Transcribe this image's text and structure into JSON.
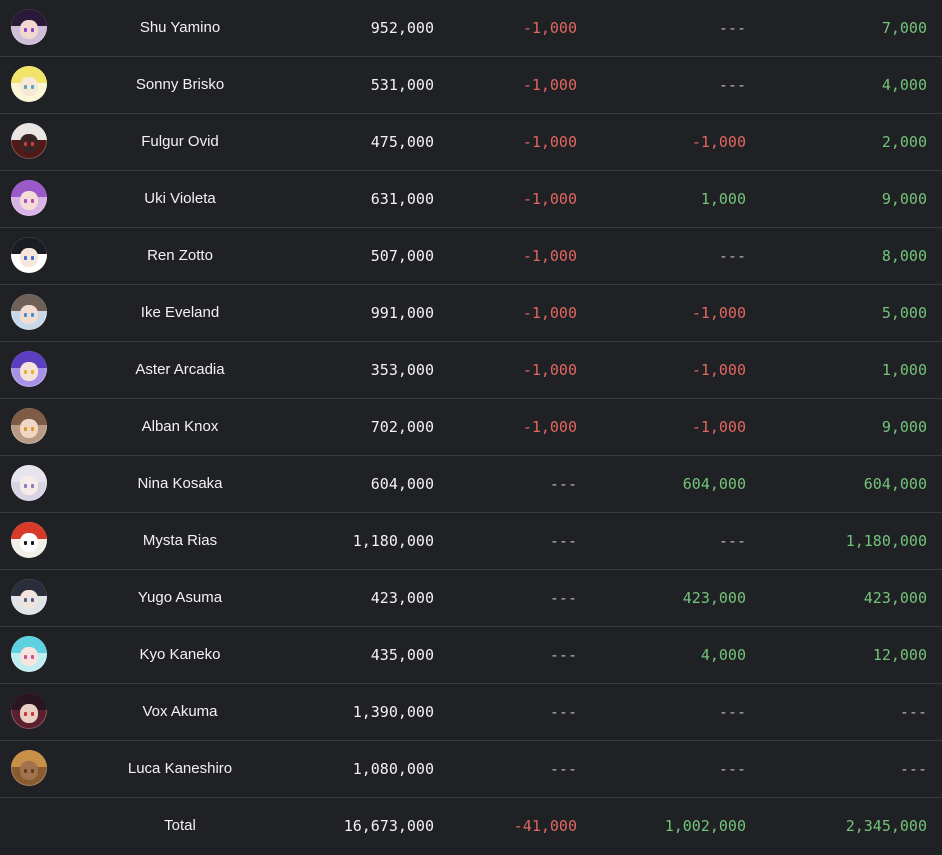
{
  "colors": {
    "background": "#202124",
    "divider": "#3a3b3e",
    "negative": "#e0675f",
    "positive": "#73c47a",
    "neutral": "#b8b8b8"
  },
  "rows": [
    {
      "name": "Shu Yamino",
      "subscribers": "952,000",
      "change_1": "-1,000",
      "change_2": "---",
      "change_3": "7,000",
      "avatar": {
        "hair": "#2a1a3a",
        "face": "#f1d9cf",
        "eye": "#8b3fd1",
        "bg": "#cfc0d8"
      }
    },
    {
      "name": "Sonny Brisko",
      "subscribers": "531,000",
      "change_1": "-1,000",
      "change_2": "---",
      "change_3": "4,000",
      "avatar": {
        "hair": "#f2e46a",
        "face": "#f7e7d6",
        "eye": "#5aa0c8",
        "bg": "#fbf6d6"
      }
    },
    {
      "name": "Fulgur Ovid",
      "subscribers": "475,000",
      "change_1": "-1,000",
      "change_2": "-1,000",
      "change_3": "2,000",
      "avatar": {
        "hair": "#e9e6e4",
        "face": "#3a2424",
        "eye": "#d43b3b",
        "bg": "#511818"
      }
    },
    {
      "name": "Uki Violeta",
      "subscribers": "631,000",
      "change_1": "-1,000",
      "change_2": "1,000",
      "change_3": "9,000",
      "avatar": {
        "hair": "#9b59c9",
        "face": "#f4dcd6",
        "eye": "#b04ab8",
        "bg": "#d8b3e6"
      }
    },
    {
      "name": "Ren Zotto",
      "subscribers": "507,000",
      "change_1": "-1,000",
      "change_2": "---",
      "change_3": "8,000",
      "avatar": {
        "hair": "#1c1c24",
        "face": "#f6e6dc",
        "eye": "#3a6fd0",
        "bg": "#ffffff"
      }
    },
    {
      "name": "Ike Eveland",
      "subscribers": "991,000",
      "change_1": "-1,000",
      "change_2": "-1,000",
      "change_3": "5,000",
      "avatar": {
        "hair": "#6f6158",
        "face": "#f3ddd0",
        "eye": "#3f8fd8",
        "bg": "#c7d8ea"
      }
    },
    {
      "name": "Aster Arcadia",
      "subscribers": "353,000",
      "change_1": "-1,000",
      "change_2": "-1,000",
      "change_3": "1,000",
      "avatar": {
        "hair": "#5b3fc0",
        "face": "#f5e2d8",
        "eye": "#e8b030",
        "bg": "#a992e6"
      }
    },
    {
      "name": "Alban Knox",
      "subscribers": "702,000",
      "change_1": "-1,000",
      "change_2": "-1,000",
      "change_3": "9,000",
      "avatar": {
        "hair": "#7d5b44",
        "face": "#f0d6c4",
        "eye": "#d89a2a",
        "bg": "#b99a84"
      }
    },
    {
      "name": "Nina Kosaka",
      "subscribers": "604,000",
      "change_1": "---",
      "change_2": "604,000",
      "change_3": "604,000",
      "avatar": {
        "hair": "#e7e4ee",
        "face": "#f7ebe6",
        "eye": "#8a78c8",
        "bg": "#d8d4e6"
      }
    },
    {
      "name": "Mysta Rias",
      "subscribers": "1,180,000",
      "change_1": "---",
      "change_2": "---",
      "change_3": "1,180,000",
      "avatar": {
        "hair": "#d83a2a",
        "face": "#ffffff",
        "eye": "#1a1a1a",
        "bg": "#f2efe9"
      }
    },
    {
      "name": "Yugo Asuma",
      "subscribers": "423,000",
      "change_1": "---",
      "change_2": "423,000",
      "change_3": "423,000",
      "avatar": {
        "hair": "#2a2d3a",
        "face": "#f1e4dc",
        "eye": "#4a5f8a",
        "bg": "#dfe3ea"
      }
    },
    {
      "name": "Kyo Kaneko",
      "subscribers": "435,000",
      "change_1": "---",
      "change_2": "4,000",
      "change_3": "12,000",
      "avatar": {
        "hair": "#5fd0e0",
        "face": "#f7e4dc",
        "eye": "#d04aa0",
        "bg": "#bfeef2"
      }
    },
    {
      "name": "Vox Akuma",
      "subscribers": "1,390,000",
      "change_1": "---",
      "change_2": "---",
      "change_3": "---",
      "avatar": {
        "hair": "#2a1620",
        "face": "#e9cfc6",
        "eye": "#c8343a",
        "bg": "#5a2030"
      }
    },
    {
      "name": "Luca Kaneshiro",
      "subscribers": "1,080,000",
      "change_1": "---",
      "change_2": "---",
      "change_3": "---",
      "avatar": {
        "hair": "#c9904a",
        "face": "#a0724e",
        "eye": "#6a3a1a",
        "bg": "#8a5a30"
      }
    }
  ],
  "total": {
    "label": "Total",
    "subscribers": "16,673,000",
    "change_1": "-41,000",
    "change_2": "1,002,000",
    "change_3": "2,345,000"
  }
}
